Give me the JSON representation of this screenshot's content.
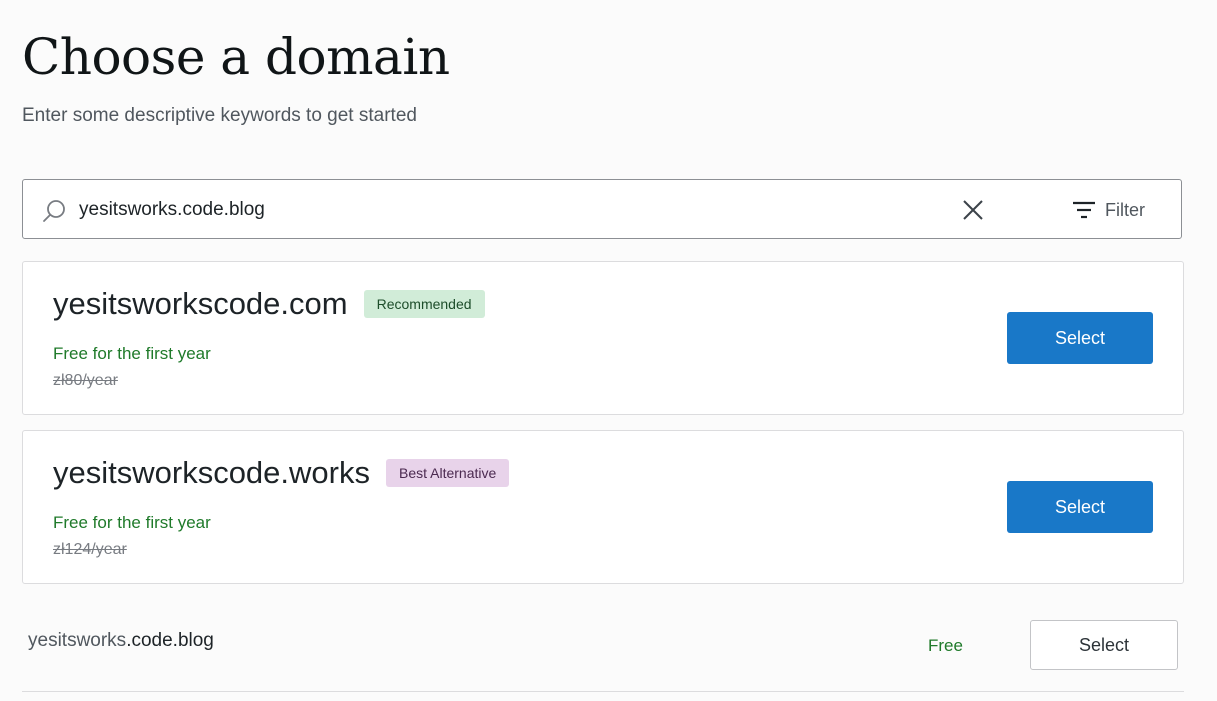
{
  "header": {
    "title": "Choose a domain",
    "subtitle": "Enter some descriptive keywords to get started"
  },
  "search": {
    "value": "yesitsworks.code.blog",
    "filter_label": "Filter",
    "icons": {
      "search": "search-icon",
      "clear": "close-icon",
      "filter": "filter-icon"
    }
  },
  "suggestions": [
    {
      "domain": "yesitsworkscode.com",
      "badge": "Recommended",
      "badge_color": "#d1ecd8",
      "promo": "Free for the first year",
      "original_price": "zł80/year",
      "button": "Select"
    },
    {
      "domain": "yesitsworkscode.works",
      "badge": "Best Alternative",
      "badge_color": "#e8d3ea",
      "promo": "Free for the first year",
      "original_price": "zł124/year",
      "button": "Select"
    }
  ],
  "free_option": {
    "domain_base": "yesitsworks",
    "domain_suffix": ".code.blog",
    "price": "Free",
    "button": "Select"
  },
  "colors": {
    "primary_button": "#1978c8",
    "free_text": "#1f7a2a"
  }
}
